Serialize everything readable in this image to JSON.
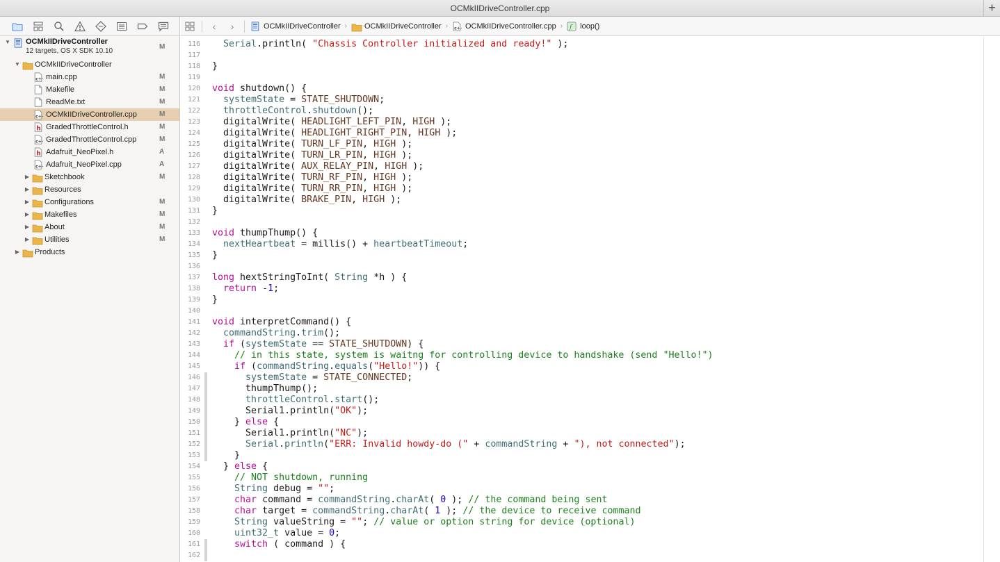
{
  "window": {
    "title": "OCMkIIDriveController.cpp",
    "add_tab_label": "+"
  },
  "navigator": {
    "toolbar_icons": [
      "folder-icon",
      "hierarchy-icon",
      "search-icon",
      "warning-icon",
      "test-diamond-icon",
      "debug-list-icon",
      "breakpoint-icon",
      "report-icon"
    ],
    "project": {
      "name": "OCMkIIDriveController",
      "subtitle": "12 targets, OS X SDK 10.10",
      "status": "M"
    },
    "items": [
      {
        "label": "OCMkIIDriveController",
        "kind": "folder",
        "indent": 1,
        "disclosure": "open",
        "status": "",
        "selected": false
      },
      {
        "label": "main.cpp",
        "kind": "cpp",
        "indent": 2,
        "disclosure": "",
        "status": "M",
        "selected": false
      },
      {
        "label": "Makefile",
        "kind": "text",
        "indent": 2,
        "disclosure": "",
        "status": "M",
        "selected": false
      },
      {
        "label": "ReadMe.txt",
        "kind": "text",
        "indent": 2,
        "disclosure": "",
        "status": "M",
        "selected": false
      },
      {
        "label": "OCMkIIDriveController.cpp",
        "kind": "cpp",
        "indent": 2,
        "disclosure": "",
        "status": "M",
        "selected": true
      },
      {
        "label": "GradedThrottleControl.h",
        "kind": "h",
        "indent": 2,
        "disclosure": "",
        "status": "M",
        "selected": false
      },
      {
        "label": "GradedThrottleControl.cpp",
        "kind": "cpp",
        "indent": 2,
        "disclosure": "",
        "status": "M",
        "selected": false
      },
      {
        "label": "Adafruit_NeoPixel.h",
        "kind": "h",
        "indent": 2,
        "disclosure": "",
        "status": "A",
        "selected": false
      },
      {
        "label": "Adafruit_NeoPixel.cpp",
        "kind": "cpp",
        "indent": 2,
        "disclosure": "",
        "status": "A",
        "selected": false
      },
      {
        "label": "Sketchbook",
        "kind": "folder",
        "indent": 2,
        "disclosure": "closed",
        "status": "M",
        "selected": false
      },
      {
        "label": "Resources",
        "kind": "folder",
        "indent": 2,
        "disclosure": "closed",
        "status": "",
        "selected": false
      },
      {
        "label": "Configurations",
        "kind": "folder",
        "indent": 2,
        "disclosure": "closed",
        "status": "M",
        "selected": false
      },
      {
        "label": "Makefiles",
        "kind": "folder",
        "indent": 2,
        "disclosure": "closed",
        "status": "M",
        "selected": false
      },
      {
        "label": "About",
        "kind": "folder",
        "indent": 2,
        "disclosure": "closed",
        "status": "M",
        "selected": false
      },
      {
        "label": "Utilities",
        "kind": "folder",
        "indent": 2,
        "disclosure": "closed",
        "status": "M",
        "selected": false
      },
      {
        "label": "Products",
        "kind": "folder",
        "indent": 1,
        "disclosure": "closed",
        "status": "",
        "selected": false
      }
    ]
  },
  "jumpbar": {
    "crumbs": [
      {
        "label": "OCMkIIDriveController",
        "icon": "project-icon"
      },
      {
        "label": "OCMkIIDriveController",
        "icon": "folder-icon"
      },
      {
        "label": "OCMkIIDriveController.cpp",
        "icon": "cpp-file-icon"
      },
      {
        "label": "loop()",
        "icon": "function-icon"
      }
    ]
  },
  "colors": {
    "keyword": "#b40f98",
    "type": "#3f6e74",
    "string": "#c41a16",
    "number": "#1c00cf",
    "comment": "#1d7f1d",
    "macro": "#643820",
    "selection": "#e6cfb0"
  },
  "code": {
    "lines": [
      {
        "n": "116",
        "m": false,
        "t": [
          [
            "  ",
            ""
          ],
          [
            "Serial",
            "ty"
          ],
          [
            ".println( ",
            ""
          ],
          [
            "\"Chassis Controller initialized and ready!\"",
            "st"
          ],
          [
            " );",
            ""
          ]
        ]
      },
      {
        "n": "117",
        "m": false,
        "t": []
      },
      {
        "n": "118",
        "m": false,
        "t": [
          [
            "}",
            ""
          ]
        ]
      },
      {
        "n": "119",
        "m": false,
        "t": []
      },
      {
        "n": "120",
        "m": false,
        "t": [
          [
            "void",
            "kw"
          ],
          [
            " shutdown() {",
            ""
          ]
        ]
      },
      {
        "n": "121",
        "m": false,
        "t": [
          [
            "  ",
            ""
          ],
          [
            "systemState",
            "fn"
          ],
          [
            " = ",
            ""
          ],
          [
            "STATE_SHUTDOWN",
            "mc"
          ],
          [
            ";",
            ""
          ]
        ]
      },
      {
        "n": "122",
        "m": false,
        "t": [
          [
            "  ",
            ""
          ],
          [
            "throttleControl",
            "fn"
          ],
          [
            ".",
            ""
          ],
          [
            "shutdown",
            "fn"
          ],
          [
            "();",
            ""
          ]
        ]
      },
      {
        "n": "123",
        "m": false,
        "t": [
          [
            "  digitalWrite( ",
            ""
          ],
          [
            "HEADLIGHT_LEFT_PIN",
            "mc"
          ],
          [
            ", ",
            ""
          ],
          [
            "HIGH",
            "mc"
          ],
          [
            " );",
            ""
          ]
        ]
      },
      {
        "n": "124",
        "m": false,
        "t": [
          [
            "  digitalWrite( ",
            ""
          ],
          [
            "HEADLIGHT_RIGHT_PIN",
            "mc"
          ],
          [
            ", ",
            ""
          ],
          [
            "HIGH",
            "mc"
          ],
          [
            " );",
            ""
          ]
        ]
      },
      {
        "n": "125",
        "m": false,
        "t": [
          [
            "  digitalWrite( ",
            ""
          ],
          [
            "TURN_LF_PIN",
            "mc"
          ],
          [
            ", ",
            ""
          ],
          [
            "HIGH",
            "mc"
          ],
          [
            " );",
            ""
          ]
        ]
      },
      {
        "n": "126",
        "m": false,
        "t": [
          [
            "  digitalWrite( ",
            ""
          ],
          [
            "TURN_LR_PIN",
            "mc"
          ],
          [
            ", ",
            ""
          ],
          [
            "HIGH",
            "mc"
          ],
          [
            " );",
            ""
          ]
        ]
      },
      {
        "n": "127",
        "m": false,
        "t": [
          [
            "  digitalWrite( ",
            ""
          ],
          [
            "AUX_RELAY_PIN",
            "mc"
          ],
          [
            ", ",
            ""
          ],
          [
            "HIGH",
            "mc"
          ],
          [
            " );",
            ""
          ]
        ]
      },
      {
        "n": "128",
        "m": false,
        "t": [
          [
            "  digitalWrite( ",
            ""
          ],
          [
            "TURN_RF_PIN",
            "mc"
          ],
          [
            ", ",
            ""
          ],
          [
            "HIGH",
            "mc"
          ],
          [
            " );",
            ""
          ]
        ]
      },
      {
        "n": "129",
        "m": false,
        "t": [
          [
            "  digitalWrite( ",
            ""
          ],
          [
            "TURN_RR_PIN",
            "mc"
          ],
          [
            ", ",
            ""
          ],
          [
            "HIGH",
            "mc"
          ],
          [
            " );",
            ""
          ]
        ]
      },
      {
        "n": "130",
        "m": false,
        "t": [
          [
            "  digitalWrite( ",
            ""
          ],
          [
            "BRAKE_PIN",
            "mc"
          ],
          [
            ", ",
            ""
          ],
          [
            "HIGH",
            "mc"
          ],
          [
            " );",
            ""
          ]
        ]
      },
      {
        "n": "131",
        "m": false,
        "t": [
          [
            "}",
            ""
          ]
        ]
      },
      {
        "n": "132",
        "m": false,
        "t": []
      },
      {
        "n": "133",
        "m": false,
        "t": [
          [
            "void",
            "kw"
          ],
          [
            " thumpThump() {",
            ""
          ]
        ]
      },
      {
        "n": "134",
        "m": false,
        "t": [
          [
            "  ",
            ""
          ],
          [
            "nextHeartbeat",
            "fn"
          ],
          [
            " = millis() + ",
            ""
          ],
          [
            "heartbeatTimeout",
            "fn"
          ],
          [
            ";",
            ""
          ]
        ]
      },
      {
        "n": "135",
        "m": false,
        "t": [
          [
            "}",
            ""
          ]
        ]
      },
      {
        "n": "136",
        "m": false,
        "t": []
      },
      {
        "n": "137",
        "m": false,
        "t": [
          [
            "long",
            "kw"
          ],
          [
            " hextStringToInt( ",
            ""
          ],
          [
            "String",
            "ty"
          ],
          [
            " *h ) {",
            ""
          ]
        ]
      },
      {
        "n": "138",
        "m": false,
        "t": [
          [
            "  ",
            ""
          ],
          [
            "return",
            "kw"
          ],
          [
            " -",
            ""
          ],
          [
            "1",
            "nu"
          ],
          [
            ";",
            ""
          ]
        ]
      },
      {
        "n": "139",
        "m": false,
        "t": [
          [
            "}",
            ""
          ]
        ]
      },
      {
        "n": "140",
        "m": false,
        "t": []
      },
      {
        "n": "141",
        "m": false,
        "t": [
          [
            "void",
            "kw"
          ],
          [
            " interpretCommand() {",
            ""
          ]
        ]
      },
      {
        "n": "142",
        "m": false,
        "t": [
          [
            "  ",
            ""
          ],
          [
            "commandString",
            "fn"
          ],
          [
            ".",
            ""
          ],
          [
            "trim",
            "fn"
          ],
          [
            "();",
            ""
          ]
        ]
      },
      {
        "n": "143",
        "m": false,
        "t": [
          [
            "  ",
            ""
          ],
          [
            "if",
            "kw"
          ],
          [
            " (",
            ""
          ],
          [
            "systemState",
            "fn"
          ],
          [
            " == ",
            ""
          ],
          [
            "STATE_SHUTDOWN",
            "mc"
          ],
          [
            ") {",
            ""
          ]
        ]
      },
      {
        "n": "144",
        "m": false,
        "t": [
          [
            "    ",
            ""
          ],
          [
            "// in this state, system is waitng for controlling device to handshake (send \"Hello!\")",
            "cm"
          ]
        ]
      },
      {
        "n": "145",
        "m": false,
        "t": [
          [
            "    ",
            ""
          ],
          [
            "if",
            "kw"
          ],
          [
            " (",
            ""
          ],
          [
            "commandString",
            "fn"
          ],
          [
            ".",
            ""
          ],
          [
            "equals",
            "fn"
          ],
          [
            "(",
            ""
          ],
          [
            "\"Hello!\"",
            "st"
          ],
          [
            ")) {",
            ""
          ]
        ]
      },
      {
        "n": "146",
        "m": true,
        "t": [
          [
            "      ",
            ""
          ],
          [
            "systemState",
            "fn"
          ],
          [
            " = ",
            ""
          ],
          [
            "STATE_CONNECTED",
            "mc"
          ],
          [
            ";",
            ""
          ]
        ]
      },
      {
        "n": "147",
        "m": true,
        "t": [
          [
            "      thumpThump();",
            ""
          ]
        ]
      },
      {
        "n": "148",
        "m": true,
        "t": [
          [
            "      ",
            ""
          ],
          [
            "throttleControl",
            "fn"
          ],
          [
            ".",
            ""
          ],
          [
            "start",
            "fn"
          ],
          [
            "();",
            ""
          ]
        ]
      },
      {
        "n": "149",
        "m": true,
        "t": [
          [
            "      Serial1.println(",
            ""
          ],
          [
            "\"OK\"",
            "st"
          ],
          [
            ");",
            ""
          ]
        ]
      },
      {
        "n": "150",
        "m": true,
        "t": [
          [
            "    } ",
            ""
          ],
          [
            "else",
            "kw"
          ],
          [
            " {",
            ""
          ]
        ]
      },
      {
        "n": "151",
        "m": true,
        "t": [
          [
            "      Serial1.println(",
            ""
          ],
          [
            "\"NC\"",
            "st"
          ],
          [
            ");",
            ""
          ]
        ]
      },
      {
        "n": "152",
        "m": true,
        "t": [
          [
            "      ",
            ""
          ],
          [
            "Serial",
            "ty"
          ],
          [
            ".",
            ""
          ],
          [
            "println",
            "fn"
          ],
          [
            "(",
            ""
          ],
          [
            "\"ERR: Invalid howdy-do (\"",
            "st"
          ],
          [
            " + ",
            ""
          ],
          [
            "commandString",
            "fn"
          ],
          [
            " + ",
            ""
          ],
          [
            "\"), not connected\"",
            "st"
          ],
          [
            ");",
            ""
          ]
        ]
      },
      {
        "n": "153",
        "m": true,
        "t": [
          [
            "    }",
            ""
          ]
        ]
      },
      {
        "n": "154",
        "m": false,
        "t": [
          [
            "  } ",
            ""
          ],
          [
            "else",
            "kw"
          ],
          [
            " {",
            ""
          ]
        ]
      },
      {
        "n": "155",
        "m": false,
        "t": [
          [
            "    ",
            ""
          ],
          [
            "// NOT shutdown, running",
            "cm"
          ]
        ]
      },
      {
        "n": "156",
        "m": false,
        "t": [
          [
            "    ",
            ""
          ],
          [
            "String",
            "ty"
          ],
          [
            " debug = ",
            ""
          ],
          [
            "\"\"",
            "st"
          ],
          [
            ";",
            ""
          ]
        ]
      },
      {
        "n": "157",
        "m": false,
        "t": [
          [
            "    ",
            ""
          ],
          [
            "char",
            "kw"
          ],
          [
            " command = ",
            ""
          ],
          [
            "commandString",
            "fn"
          ],
          [
            ".",
            ""
          ],
          [
            "charAt",
            "fn"
          ],
          [
            "( ",
            ""
          ],
          [
            "0",
            "nu"
          ],
          [
            " ); ",
            ""
          ],
          [
            "// the command being sent",
            "cm"
          ]
        ]
      },
      {
        "n": "158",
        "m": false,
        "t": [
          [
            "    ",
            ""
          ],
          [
            "char",
            "kw"
          ],
          [
            " target = ",
            ""
          ],
          [
            "commandString",
            "fn"
          ],
          [
            ".",
            ""
          ],
          [
            "charAt",
            "fn"
          ],
          [
            "( ",
            ""
          ],
          [
            "1",
            "nu"
          ],
          [
            " ); ",
            ""
          ],
          [
            "// the device to receive command",
            "cm"
          ]
        ]
      },
      {
        "n": "159",
        "m": false,
        "t": [
          [
            "    ",
            ""
          ],
          [
            "String",
            "ty"
          ],
          [
            " valueString = ",
            ""
          ],
          [
            "\"\"",
            "st"
          ],
          [
            "; ",
            ""
          ],
          [
            "// value or option string for device (optional)",
            "cm"
          ]
        ]
      },
      {
        "n": "160",
        "m": false,
        "t": [
          [
            "    ",
            ""
          ],
          [
            "uint32_t",
            "ty"
          ],
          [
            " value = ",
            ""
          ],
          [
            "0",
            "nu"
          ],
          [
            ";",
            ""
          ]
        ]
      },
      {
        "n": "161",
        "m": true,
        "t": [
          [
            "    ",
            ""
          ],
          [
            "switch",
            "kw"
          ],
          [
            " ( command ) {",
            ""
          ]
        ]
      },
      {
        "n": "162",
        "m": true,
        "t": []
      }
    ]
  }
}
